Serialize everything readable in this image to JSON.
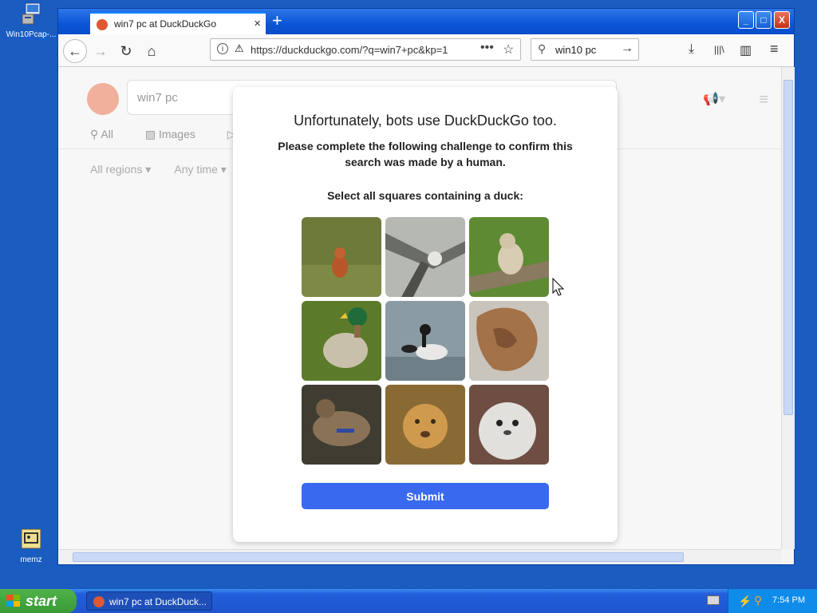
{
  "desktop": {
    "icons": [
      {
        "label": "Win10Pcap-..."
      },
      {
        "label": "memz"
      }
    ]
  },
  "browser": {
    "tab_title": "win7 pc at DuckDuckGo",
    "tab_close": "×",
    "new_tab": "+",
    "window_buttons": {
      "minimize": "_",
      "maximize": "□",
      "close": "X"
    },
    "nav": {
      "back": "←",
      "forward": "→",
      "reload": "↻",
      "home": "⌂"
    },
    "url": "https://duckduckgo.com/?q=win7+pc&kp=1",
    "url_menu": "•••",
    "bookmark_star": "☆",
    "search_value": "win10 pc",
    "search_go": "→",
    "toolbar": {
      "download": "⤓",
      "library": "|||\\",
      "sidebar": "▥",
      "menu": "≡"
    }
  },
  "ddg": {
    "query": "win7 pc",
    "tabs": [
      "All",
      "Images",
      "Vi"
    ],
    "filters": [
      "All regions ▾",
      "Any time ▾"
    ]
  },
  "challenge": {
    "heading": "Unfortunately, bots use DuckDuckGo too.",
    "message": "Please complete the following challenge to confirm this search was made by a human.",
    "instruction": "Select all squares containing a duck:",
    "tiles": [
      {
        "name": "tile-monkey",
        "bg": "#6e7a3a"
      },
      {
        "name": "tile-bird-branches",
        "bg": "#8a8d88"
      },
      {
        "name": "tile-lynx",
        "bg": "#6f9540"
      },
      {
        "name": "tile-mallard-duck",
        "bg": "#5c7b2a"
      },
      {
        "name": "tile-ducks-water",
        "bg": "#7c8f98"
      },
      {
        "name": "tile-dried-object",
        "bg": "#c9c4bc"
      },
      {
        "name": "tile-female-duck",
        "bg": "#4c4a3c"
      },
      {
        "name": "tile-lion-cub",
        "bg": "#a37b3e"
      },
      {
        "name": "tile-seal",
        "bg": "#77564a"
      }
    ],
    "submit_label": "Submit"
  },
  "taskbar": {
    "start_label": "start",
    "task_label": "win7 pc at DuckDuck...",
    "clock": "7:54 PM"
  }
}
